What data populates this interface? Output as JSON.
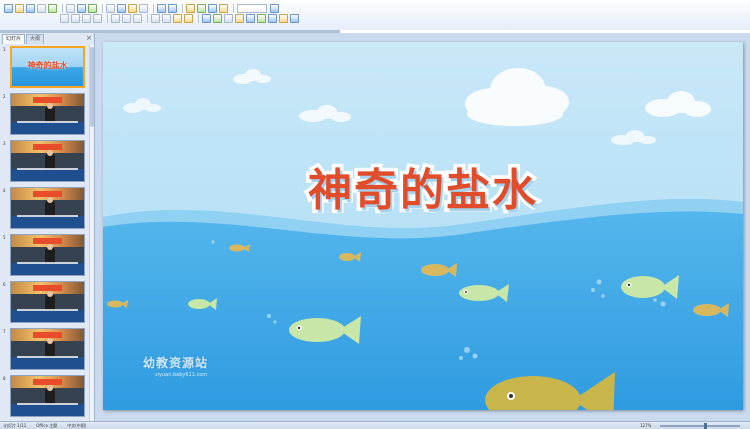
{
  "pane_tabs": [
    {
      "label": "幻灯片",
      "active": true
    },
    {
      "label": "大纲",
      "active": false
    }
  ],
  "thumbnails": [
    {
      "number": "1",
      "kind": "title",
      "title": "神奇的盐水",
      "selected": true
    },
    {
      "number": "2",
      "kind": "video",
      "selected": false
    },
    {
      "number": "3",
      "kind": "video",
      "selected": false
    },
    {
      "number": "4",
      "kind": "video",
      "selected": false
    },
    {
      "number": "5",
      "kind": "video",
      "selected": false
    },
    {
      "number": "6",
      "kind": "video",
      "selected": false
    },
    {
      "number": "7",
      "kind": "video",
      "selected": false
    },
    {
      "number": "8",
      "kind": "video",
      "selected": false
    }
  ],
  "slide": {
    "title": "神奇的盐水",
    "title_color": "#e14d2a",
    "sky_color": "#bfe2f7",
    "water_color": "#3aa6e6"
  },
  "watermark": {
    "text": "幼教资源站",
    "url": "ziyuan.baby611.com"
  },
  "statusbar": {
    "slide_info": "幻灯片 1/11",
    "theme": "Office 主题",
    "language": "中文(中国)",
    "zoom": "127%"
  }
}
